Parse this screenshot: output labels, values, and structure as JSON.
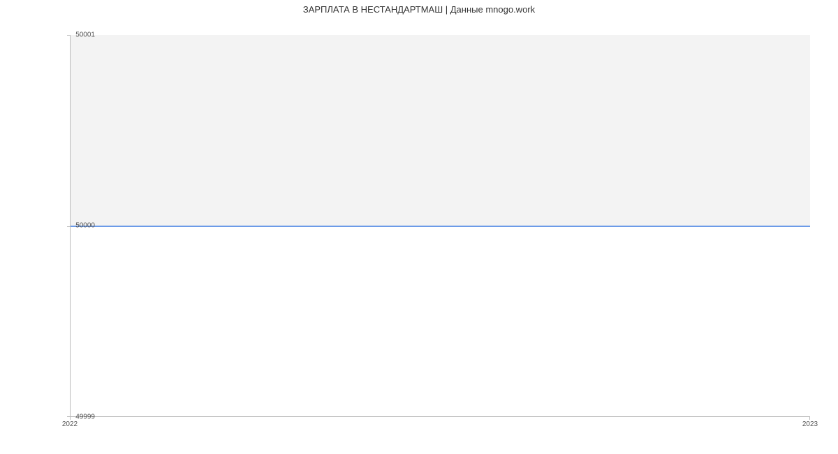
{
  "chart_data": {
    "type": "area",
    "title": "ЗАРПЛАТА В НЕСТАНДАРТМАШ | Данные mnogo.work",
    "x": [
      2022,
      2023
    ],
    "values": [
      50000,
      50000
    ],
    "ylim": [
      49999,
      50001
    ],
    "xlim": [
      2022,
      2023
    ],
    "y_ticks": [
      49999,
      50000,
      50001
    ],
    "x_ticks": [
      2022,
      2023
    ],
    "xlabel": "",
    "ylabel": ""
  }
}
